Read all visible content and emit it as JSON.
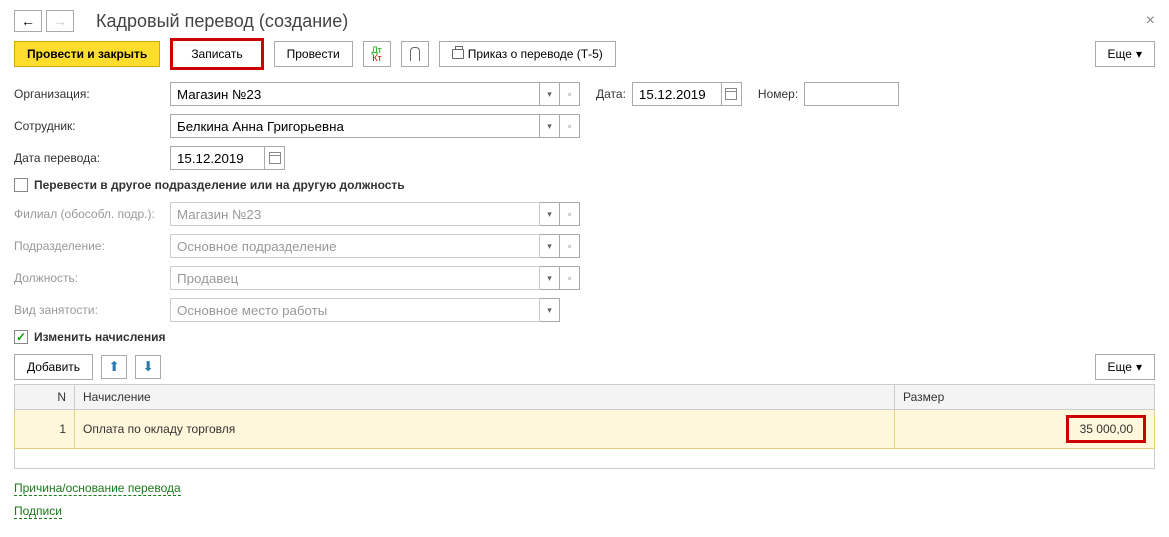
{
  "title": "Кадровый перевод (создание)",
  "toolbar": {
    "submit_close": "Провести и закрыть",
    "save": "Записать",
    "submit": "Провести",
    "print_order": "Приказ о переводе (Т-5)",
    "more": "Еще"
  },
  "fields": {
    "org_label": "Организация:",
    "org_value": "Магазин №23",
    "date_label": "Дата:",
    "date_value": "15.12.2019",
    "number_label": "Номер:",
    "number_value": "",
    "employee_label": "Сотрудник:",
    "employee_value": "Белкина Анна Григорьевна",
    "transfer_date_label": "Дата перевода:",
    "transfer_date_value": "15.12.2019",
    "transfer_checkbox": "Перевести в другое подразделение или на другую должность",
    "branch_label": "Филиал (обособл. подр.):",
    "branch_value": "Магазин №23",
    "division_label": "Подразделение:",
    "division_value": "Основное подразделение",
    "position_label": "Должность:",
    "position_value": "Продавец",
    "employment_label": "Вид занятости:",
    "employment_value": "Основное место работы",
    "change_accruals": "Изменить начисления"
  },
  "table_toolbar": {
    "add": "Добавить",
    "more": "Еще"
  },
  "table": {
    "headers": {
      "n": "N",
      "accrual": "Начисление",
      "size": "Размер"
    },
    "rows": [
      {
        "n": "1",
        "accrual": "Оплата по окладу торговля",
        "size": "35 000,00"
      }
    ]
  },
  "links": {
    "reason": "Причина/основание перевода",
    "signatures": "Подписи"
  }
}
